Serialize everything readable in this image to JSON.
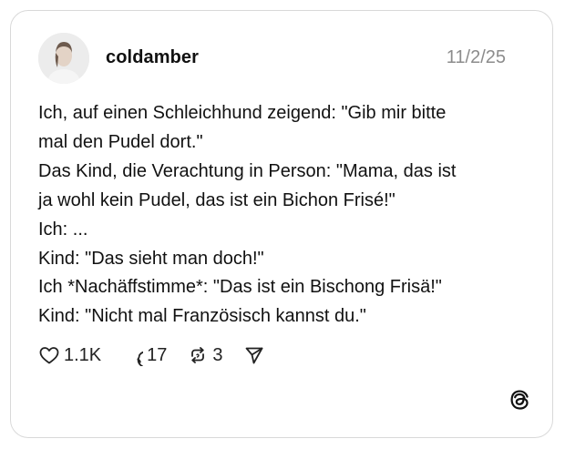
{
  "post": {
    "username": "coldamber",
    "date": "11/2/25",
    "lines": [
      "Ich, auf einen Schleichhund zeigend: \"Gib mir bitte",
      "mal den Pudel dort.\"",
      "Das Kind, die Verachtung in Person: \"Mama, das ist",
      "ja wohl kein Pudel, das ist ein Bichon Frisé!\"",
      "Ich: ...",
      "Kind: \"Das sieht man doch!\"",
      "Ich *Nachäffstimme*: \"Das ist ein Bischong Frisä!\"",
      "Kind: \"Nicht mal Französisch kannst du.\""
    ]
  },
  "actions": {
    "likes": "1.1K",
    "replies": "17",
    "reposts": "3"
  },
  "icons": {
    "like": "heart-icon",
    "reply": "comment-icon",
    "repost": "repost-icon",
    "share": "send-icon",
    "brand": "threads-logo-icon"
  },
  "colors": {
    "text": "#111111",
    "muted": "#8c8c8c",
    "border": "#d9d9d9"
  }
}
